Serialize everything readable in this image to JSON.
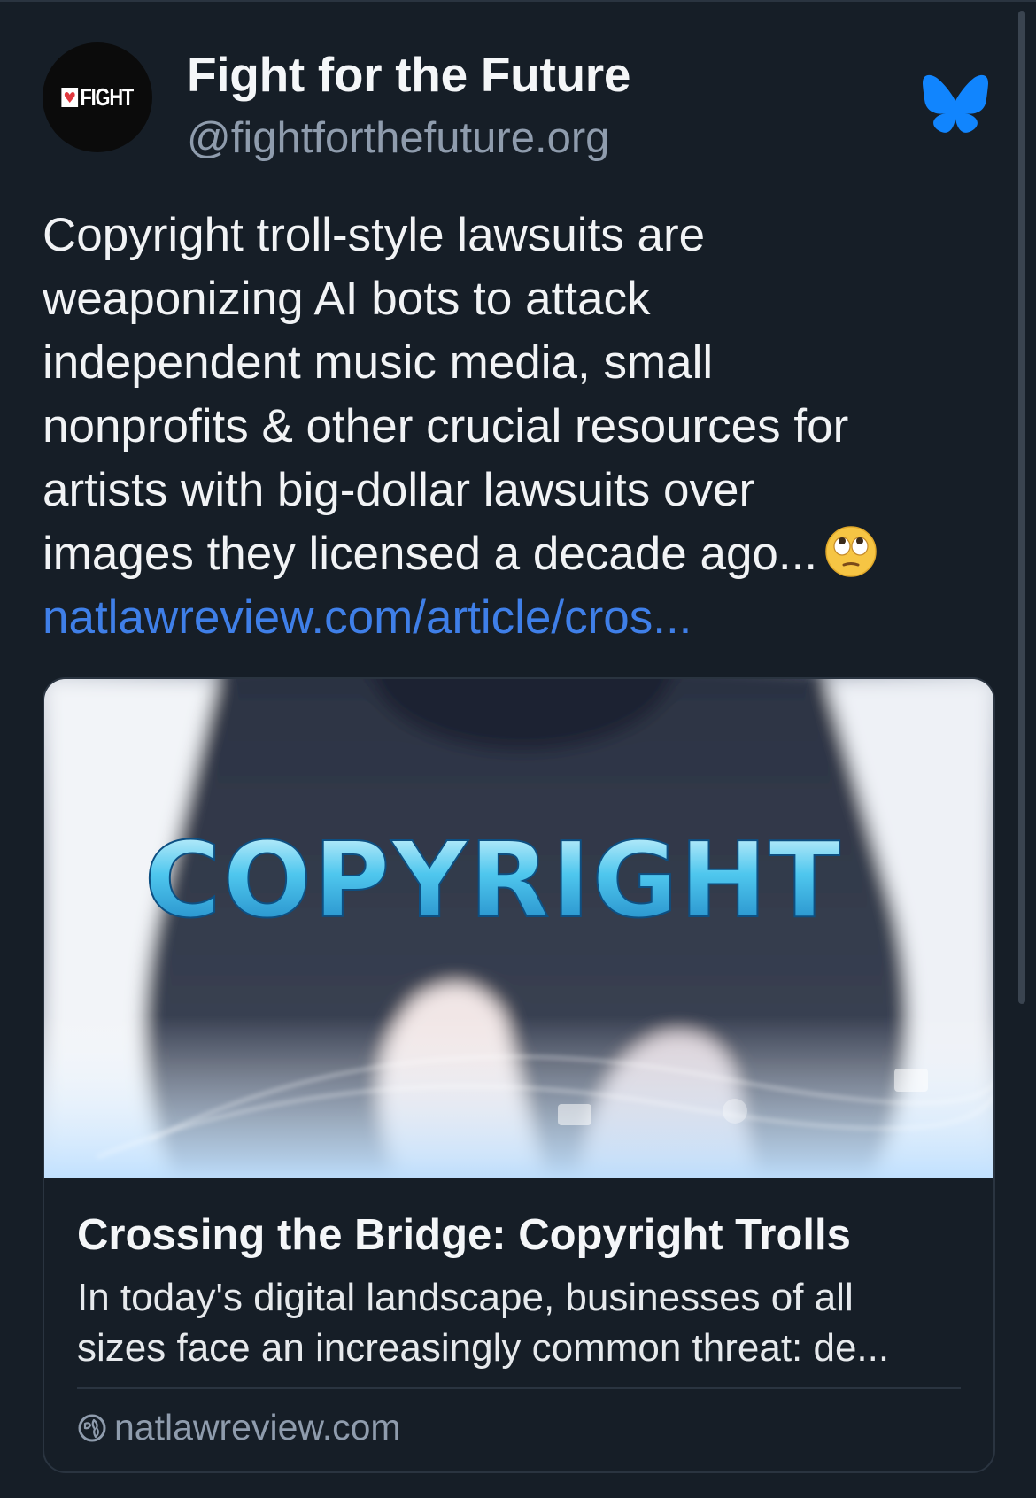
{
  "post": {
    "author": {
      "name": "Fight for the Future",
      "handle": "@fightforthefuture.org",
      "avatar_logo_text": "FIGHT"
    },
    "text_lines": [
      "Copyright troll-style lawsuits are",
      "weaponizing AI bots to attack",
      "independent music media, small",
      "nonprofits & other crucial resources for",
      "artists with big-dollar lawsuits over",
      "images they licensed a decade ago..."
    ],
    "emoji": "face-with-rolling-eyes",
    "link_text": "natlawreview.com/article/cros..."
  },
  "link_card": {
    "image_text": "COPYRIGHT",
    "title": "Crossing the Bridge: Copyright Trolls",
    "description_lines": [
      "In today's digital landscape, businesses of all",
      "sizes face an increasingly common threat: de..."
    ],
    "domain": "natlawreview.com"
  },
  "icons": {
    "platform": "bluesky-butterfly-icon",
    "domain": "globe-icon"
  },
  "colors": {
    "background": "#161e27",
    "link": "#3f7fe8",
    "bluesky": "#1185fe",
    "secondary_text": "#8f9cad"
  }
}
